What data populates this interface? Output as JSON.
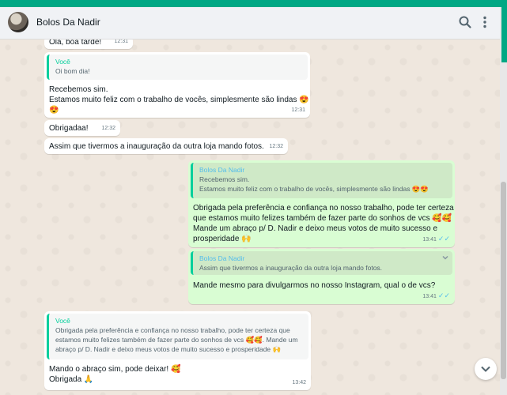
{
  "header": {
    "contact_name": "Bolos Da Nadir",
    "icons": [
      "search-icon",
      "menu-icon"
    ]
  },
  "colors": {
    "accent": "#00a884",
    "incoming": "#ffffff",
    "outgoing": "#d9fdd3",
    "quote_bar": "#06cf9c",
    "read_checks": "#53bdeb"
  },
  "messages": {
    "m1": {
      "text": "Olá, boa tarde!",
      "time": "12:31"
    },
    "m2": {
      "quote_author": "Você",
      "quote_text": "Oi bom dia!",
      "line1": "Recebemos sim.",
      "line2": "Estamos muito feliz com o trabalho de vocês, simplesmente são lindas 😍",
      "line3": "😍",
      "time": "12:31"
    },
    "m3": {
      "text": "Obrigadaa!",
      "time": "12:32"
    },
    "m4": {
      "text": "Assim que tivermos a inauguração da outra loja mando fotos.",
      "time": "12:32"
    },
    "m5": {
      "quote_author": "Bolos Da Nadir",
      "quote_line1": "Recebemos sim.",
      "quote_line2": "Estamos muito feliz com o trabalho de vocês, simplesmente são lindas 😍😍",
      "line1": "Obrigada pela preferência e confiança no nosso trabalho, pode ter certeza",
      "line2": "que estamos muito felizes também de fazer parte do sonhos de vcs 🥰🥰",
      "line3": "Mande um abraço p/ D. Nadir e deixo meus votos de muito sucesso e",
      "line4": "prosperidade 🙌",
      "time": "13:41"
    },
    "m6": {
      "quote_author": "Bolos Da Nadir",
      "quote_text": "Assim que tivermos a inauguração da outra loja mando fotos.",
      "text": "Mande mesmo para divulgarmos no nosso Instagram, qual o de vcs?",
      "time": "13:41"
    },
    "m7": {
      "quote_author": "Você",
      "quote_line1": "Obrigada pela preferência e confiança no nosso trabalho, pode ter certeza que",
      "quote_line2": "estamos muito felizes também de fazer parte do sonhos de vcs 🥰🥰. Mande um",
      "quote_line3": "abraço p/ D. Nadir e deixo meus votos de muito sucesso e prosperidade 🙌",
      "line1": "Mando o abraço sim, pode deixar! 🥰",
      "line2": "Obrigada 🙏",
      "time": "13:42"
    }
  },
  "checks": "✓✓"
}
